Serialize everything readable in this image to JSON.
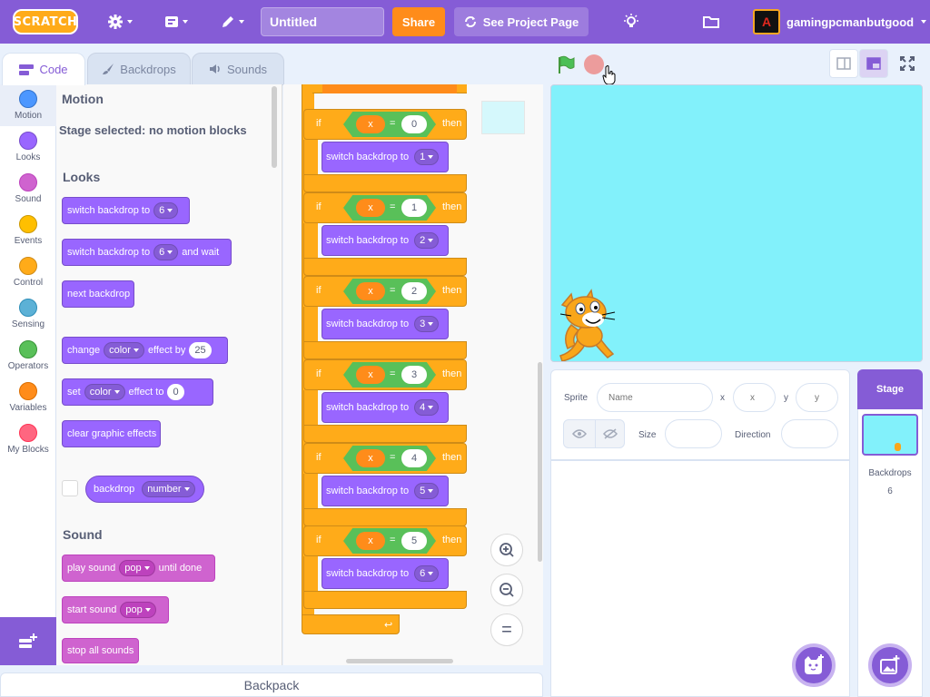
{
  "menubar": {
    "logo": "SCRATCH",
    "title_value": "Untitled",
    "share": "Share",
    "see_project": "See Project Page",
    "avatar_letter": "A",
    "username": "gamingpcmanbutgood"
  },
  "tabs": {
    "code": "Code",
    "backdrops": "Backdrops",
    "sounds": "Sounds"
  },
  "categories": [
    {
      "label": "Motion",
      "color": "#4c97ff"
    },
    {
      "label": "Looks",
      "color": "#9966ff"
    },
    {
      "label": "Sound",
      "color": "#cf63cf"
    },
    {
      "label": "Events",
      "color": "#ffbf00"
    },
    {
      "label": "Control",
      "color": "#ffab19"
    },
    {
      "label": "Sensing",
      "color": "#5cb1d6"
    },
    {
      "label": "Operators",
      "color": "#59c059"
    },
    {
      "label": "Variables",
      "color": "#ff8c1a"
    },
    {
      "label": "My Blocks",
      "color": "#ff6680"
    }
  ],
  "palette": {
    "motion_heading": "Motion",
    "motion_note": "Stage selected: no motion blocks",
    "looks_heading": "Looks",
    "switch_backdrop_to": "switch backdrop to",
    "backdrop_value": "6",
    "and_wait": "and wait",
    "next_backdrop": "next backdrop",
    "change": "change",
    "color_opt": "color",
    "effect_by": "effect by",
    "effect_by_value": "25",
    "set": "set",
    "effect_to": "effect to",
    "effect_to_value": "0",
    "clear_effects": "clear graphic effects",
    "backdrop": "backdrop",
    "number_opt": "number",
    "sound_heading": "Sound",
    "play_sound": "play sound",
    "pop": "pop",
    "until_done": "until done",
    "start_sound": "start sound",
    "stop_all_sounds": "stop all sounds"
  },
  "script": {
    "if_label": "if",
    "then_label": "then",
    "var_x": "x",
    "eq": "=",
    "switch_label": "switch backdrop to",
    "blocks": [
      {
        "cond": "0",
        "backdrop": "1"
      },
      {
        "cond": "1",
        "backdrop": "2"
      },
      {
        "cond": "2",
        "backdrop": "3"
      },
      {
        "cond": "3",
        "backdrop": "4"
      },
      {
        "cond": "4",
        "backdrop": "5"
      },
      {
        "cond": "5",
        "backdrop": "6"
      }
    ]
  },
  "zoom": {
    "reset": "="
  },
  "backpack": "Backpack",
  "sprite_info": {
    "sprite_label": "Sprite",
    "name_placeholder": "Name",
    "x_label": "x",
    "x_placeholder": "x",
    "y_label": "y",
    "y_placeholder": "y",
    "size_label": "Size",
    "direction_label": "Direction"
  },
  "stage_panel": {
    "title": "Stage",
    "backdrops_label": "Backdrops",
    "backdrops_count": "6"
  }
}
